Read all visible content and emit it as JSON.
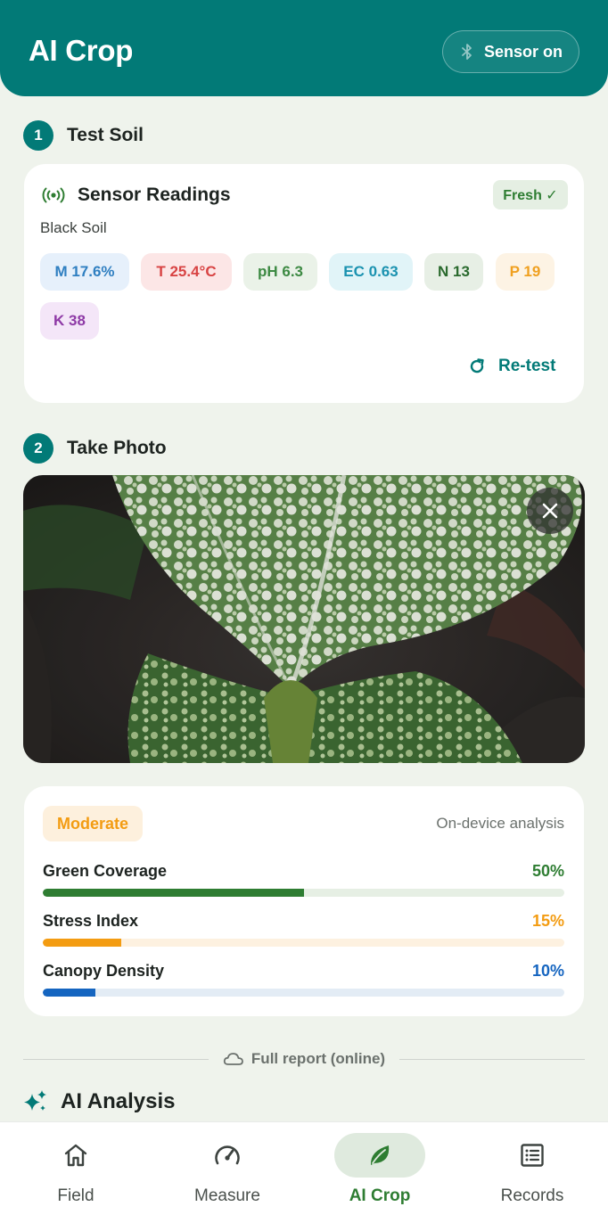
{
  "header": {
    "title": "AI Crop",
    "sensor_button": "Sensor on"
  },
  "steps": [
    {
      "number": "1",
      "label": "Test Soil"
    },
    {
      "number": "2",
      "label": "Take Photo"
    }
  ],
  "sensor_card": {
    "title": "Sensor Readings",
    "badge": "Fresh ✓",
    "soil_type": "Black Soil",
    "readings": [
      {
        "label": "M 17.6%",
        "color": "#2f7fc1",
        "bg": "#e6f0fb"
      },
      {
        "label": "T 25.4°C",
        "color": "#d84343",
        "bg": "#fce6e6"
      },
      {
        "label": "pH 6.3",
        "color": "#3d8a43",
        "bg": "#eaf2e8"
      },
      {
        "label": "EC 0.63",
        "color": "#1b92b0",
        "bg": "#e1f4f8"
      },
      {
        "label": "N 13",
        "color": "#2a6a2e",
        "bg": "#e7efe5"
      },
      {
        "label": "P 19",
        "color": "#f0a020",
        "bg": "#fdf3e4"
      },
      {
        "label": "K 38",
        "color": "#8e3aa6",
        "bg": "#f4e6f8"
      }
    ],
    "retest_label": "Re-test"
  },
  "analysis": {
    "status": "Moderate",
    "source": "On-device analysis",
    "metrics": [
      {
        "label": "Green Coverage",
        "value_text": "50%",
        "value": 0.5,
        "color": "#2e7d32",
        "track": "#e6efe4"
      },
      {
        "label": "Stress Index",
        "value_text": "15%",
        "value": 0.15,
        "color": "#f39c12",
        "track": "#fdf1e0"
      },
      {
        "label": "Canopy Density",
        "value_text": "10%",
        "value": 0.1,
        "color": "#1565c0",
        "track": "#e3ecf5"
      }
    ]
  },
  "full_report_label": "Full report (online)",
  "ai_analysis_title": "AI Analysis",
  "nav": [
    {
      "label": "Field",
      "icon": "home-icon",
      "active": false
    },
    {
      "label": "Measure",
      "icon": "gauge-icon",
      "active": false
    },
    {
      "label": "AI Crop",
      "icon": "leaf-icon",
      "active": true
    },
    {
      "label": "Records",
      "icon": "list-icon",
      "active": false
    }
  ]
}
